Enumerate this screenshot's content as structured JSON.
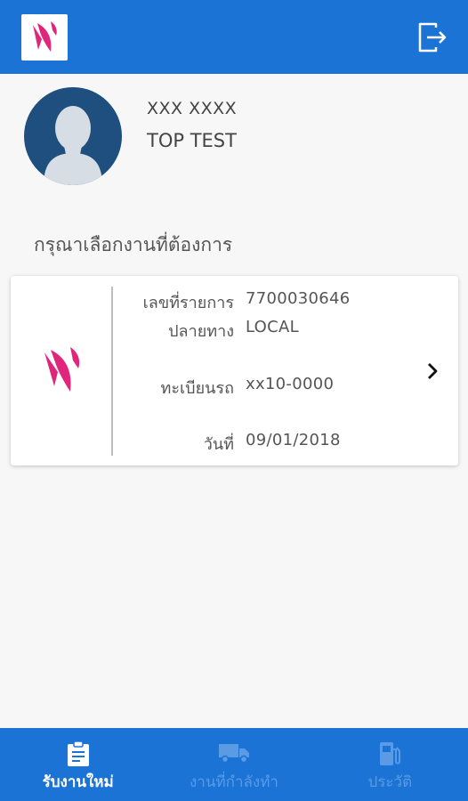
{
  "colors": {
    "header_bg": "#1b73d6",
    "brand_pink": "#e0267a",
    "nav_active": "#ffffff",
    "nav_inactive": "#5a9be4"
  },
  "header": {
    "logo_icon": "brand-logo-icon",
    "logout_icon": "logout-icon"
  },
  "profile": {
    "user_id": "XXX XXXX",
    "user_name": "TOP TEST",
    "avatar_icon": "user-silhouette-icon"
  },
  "prompt": "กรุณาเลือกงานที่ต้องการ",
  "job_card": {
    "item_no_label": "เลขที่รายการ",
    "item_no": "7700030646",
    "destination_label": "ปลายทาง",
    "destination": "LOCAL",
    "plate_label": "ทะเบียนรถ",
    "plate": "xx10-0000",
    "date_label": "วันที่",
    "date": "09/01/2018"
  },
  "bottom_nav": {
    "items": [
      {
        "label": "รับงานใหม่",
        "icon": "clipboard-icon",
        "active": true
      },
      {
        "label": "งานที่กำลังทำ",
        "icon": "truck-icon",
        "active": false
      },
      {
        "label": "ประวัติ",
        "icon": "fuel-pump-icon",
        "active": false
      }
    ]
  }
}
